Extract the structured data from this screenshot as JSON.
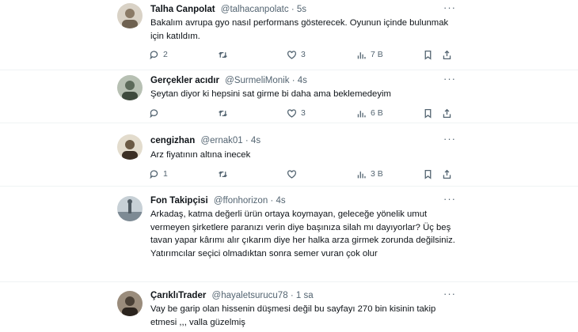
{
  "tweets": [
    {
      "name": "Talha Canpolat",
      "handle": "@talhacanpolatc",
      "time": "5s",
      "text": "Bakalım avrupa gyo nasıl performans gösterecek. Oyunun içinde bulunmak için katıldım.",
      "replies": "2",
      "retweets": "",
      "likes": "3",
      "views": "7 B",
      "avatar_color": "#8a7a66"
    },
    {
      "name": "Gerçekler acıdır",
      "handle": "@SurmeliMonik",
      "time": "4s",
      "text": "Şeytan diyor ki hepsini sat girme bi daha ama beklemedeyim",
      "replies": "",
      "retweets": "",
      "likes": "3",
      "views": "6 B",
      "avatar_color": "#5c6a5a"
    },
    {
      "name": "cengizhan",
      "handle": "@ernak01",
      "time": "4s",
      "text": "Arz fiyatının altına inecek",
      "replies": "1",
      "retweets": "",
      "likes": "",
      "views": "3 B",
      "avatar_color": "#6b5a44"
    },
    {
      "name": "Fon Takipçisi",
      "handle": "@ffonhorizon",
      "time": "4s",
      "text": "Arkadaş, katma değerli ürün ortaya koymayan, geleceğe yönelik umut vermeyen şirketlere paranızı verin diye başınıza silah mı dayıyorlar? Üç beş tavan yapar kârımı alır çıkarım diye her halka arza girmek zorunda değilsiniz. Yatırımcılar seçici olmadıktan sonra semer vuran çok olur",
      "replies": "",
      "retweets": "",
      "likes": "",
      "views": "",
      "avatar_color": "#7d8a94"
    },
    {
      "name": "ÇarıklıTrader",
      "handle": "@hayaletsurucu78",
      "time": "1 sa",
      "text": "Vay be garip olan hissenin düşmesi değil bu sayfayı 270 bin kisinin takip etmesi ,,, valla güzelmiş",
      "replies": "",
      "retweets": "",
      "likes": "",
      "views": "",
      "avatar_color": "#4a4036"
    }
  ],
  "icons": [
    "reply-icon",
    "retweet-icon",
    "like-icon",
    "views-icon",
    "bookmark-icon",
    "share-icon",
    "more-icon"
  ],
  "colors": {
    "text": "#0f1419",
    "secondary": "#536471",
    "divider": "#eff3f4"
  }
}
